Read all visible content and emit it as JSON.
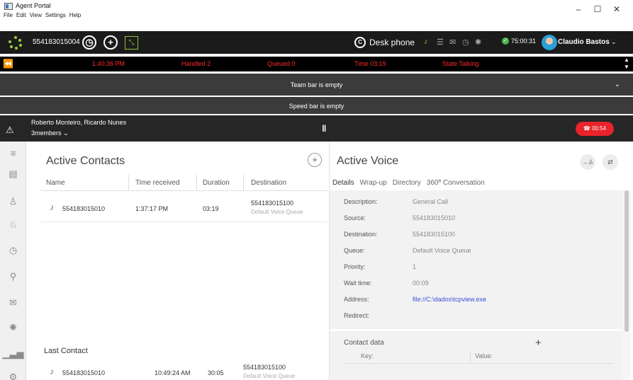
{
  "window": {
    "title": "Agent Portal",
    "menu": [
      "File",
      "Edit",
      "View",
      "Settings",
      "Help"
    ],
    "controls": {
      "minimize": "–",
      "maximize": "☐",
      "close": "✕"
    }
  },
  "agentbar": {
    "extension": "554183015004",
    "deskphone_label": "Desk phone",
    "status_time": "75:00:31",
    "user_name": "Claudio Bastos",
    "accent": "#8ec63f"
  },
  "infostrip": {
    "clock": "1:40:36 PM",
    "handled": "Handled 2",
    "queued": "Queued 0",
    "time": "Time 03:19",
    "state": "State Talking",
    "color": "#ff2a2a"
  },
  "teambar": {
    "label": "Team bar is empty"
  },
  "speedbar": {
    "label": "Speed bar is empty"
  },
  "conference": {
    "names": "Roberto Monteiro, Ricardo Nunes",
    "members": "3members ⌄",
    "hangup_time": "00:54",
    "hangup_color": "#e8232a"
  },
  "contacts": {
    "title": "Active Contacts",
    "columns": [
      "Name",
      "Time received",
      "Duration",
      "Destination"
    ],
    "rows": [
      {
        "name": "554183015010",
        "time": "1:37:17 PM",
        "duration": "03:19",
        "destination": "554183015100",
        "queue": "Default Voice Queue"
      }
    ],
    "last_title": "Last Contact",
    "last": {
      "name": "554183015010",
      "time": "10:49:24 AM",
      "duration": "30:05",
      "destination": "554183015100",
      "queue": "Default Voice Queue"
    }
  },
  "voice": {
    "title": "Active Voice",
    "tabs": [
      "Details",
      "Wrap-up",
      "Directory",
      "360º Conversation"
    ],
    "details": [
      {
        "label": "Description:",
        "value": "General Call"
      },
      {
        "label": "Source:",
        "value": "554183015010"
      },
      {
        "label": "Destination:",
        "value": "554183015100"
      },
      {
        "label": "Queue:",
        "value": "Default Voice Queue"
      },
      {
        "label": "Priority:",
        "value": "1"
      },
      {
        "label": "Wait time:",
        "value": "00:09"
      },
      {
        "label": "Address:",
        "value": "file://C:\\dados\\tcpview.exe"
      },
      {
        "label": "Redirect:",
        "value": ""
      }
    ],
    "contact_data": {
      "title": "Contact data",
      "key_label": "Key:",
      "value_label": "Value:"
    }
  }
}
